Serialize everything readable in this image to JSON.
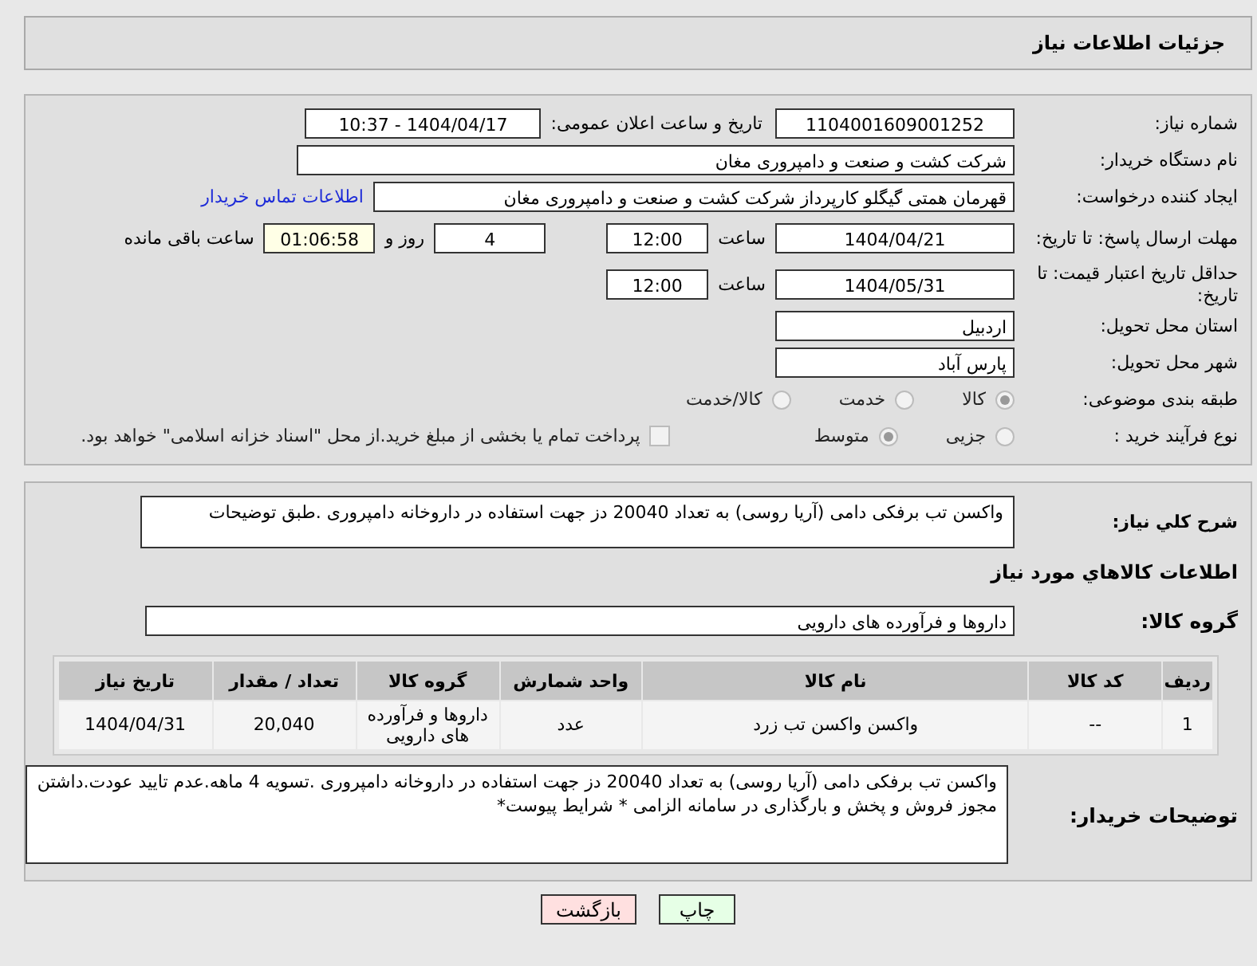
{
  "header": {
    "title": "جزئیات اطلاعات نیاز"
  },
  "form": {
    "need_number": {
      "label": "شماره نیاز:",
      "value": "1104001609001252"
    },
    "announce": {
      "label": "تاریخ و ساعت اعلان عمومی:",
      "value": "1404/04/17 - 10:37"
    },
    "buyer_org": {
      "label": "نام دستگاه خریدار:",
      "value": "شرکت کشت و صنعت و دامپروری مغان"
    },
    "requester": {
      "label": "ایجاد کننده درخواست:",
      "value": "قهرمان همتی گیگلو کارپرداز شرکت کشت و صنعت و دامپروری مغان",
      "link": "اطلاعات تماس خریدار"
    },
    "reply_deadline": {
      "label": "مهلت ارسال پاسخ: تا تاریخ:",
      "date": "1404/04/21",
      "time_label": "ساعت",
      "time": "12:00",
      "days": "4",
      "days_label": "روز و",
      "remaining": "01:06:58",
      "remaining_label": "ساعت باقی مانده"
    },
    "price_validity": {
      "label": "حداقل تاریخ اعتبار قیمت: تا تاریخ:",
      "date": "1404/05/31",
      "time_label": "ساعت",
      "time": "12:00"
    },
    "province": {
      "label": "استان محل تحویل:",
      "value": "اردبیل"
    },
    "city": {
      "label": "شهر محل تحویل:",
      "value": "پارس آباد"
    },
    "category": {
      "label": "طبقه بندی موضوعی:",
      "options": [
        {
          "label": "کالا",
          "selected": true
        },
        {
          "label": "خدمت",
          "selected": false
        },
        {
          "label": "کالا/خدمت",
          "selected": false
        }
      ]
    },
    "process": {
      "label": "نوع فرآیند خرید :",
      "options": [
        {
          "label": "جزیی",
          "selected": false
        },
        {
          "label": "متوسط",
          "selected": true
        }
      ],
      "payment": {
        "checked": false,
        "label": "پرداخت تمام یا بخشی از مبلغ خرید.از محل \"اسناد خزانه اسلامی\" خواهد بود."
      }
    }
  },
  "description": {
    "label": "شرح کلي نياز:",
    "value": "واکسن تب برفکی دامی (آریا روسی) به تعداد 20040 دز جهت استفاده در داروخانه دامپروری .طبق توضیحات"
  },
  "goods": {
    "heading": "اطلاعات کالاهاي مورد نياز",
    "group_label": "گروه کالا:",
    "group": "داروها و فرآورده های دارویی",
    "table": {
      "columns": [
        "ردیف",
        "کد کالا",
        "نام کالا",
        "واحد شمارش",
        "گروه کالا",
        "تعداد / مقدار",
        "تاریخ نیاز"
      ],
      "rows": [
        [
          "1",
          "--",
          "واکسن واکسن تب زرد",
          "عدد",
          "داروها و فرآورده های دارویی",
          "20,040",
          "1404/04/31"
        ]
      ]
    }
  },
  "buyer_notes": {
    "label": "توضیحات خریدار:",
    "value": "واکسن تب برفکی دامی (آریا روسی) به تعداد 20040 دز جهت استفاده در داروخانه دامپروری .تسویه 4 ماهه.عدم تایید عودت.داشتن مجوز فروش و پخش و بارگذاری در سامانه الزامی * شرایط پیوست*"
  },
  "buttons": [
    {
      "label": "چاپ",
      "kind": "print"
    },
    {
      "label": "بازگشت",
      "kind": "back"
    }
  ]
}
